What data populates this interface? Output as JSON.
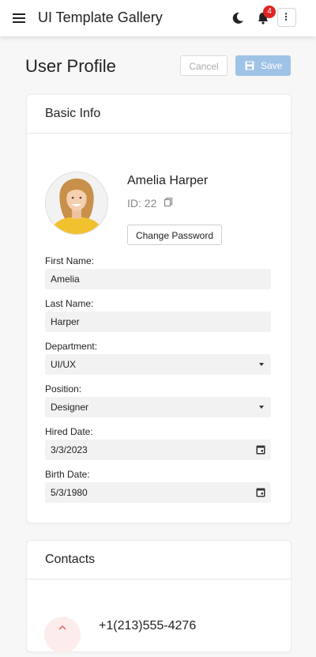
{
  "app": {
    "title": "UI Template Gallery",
    "notifications_count": "4"
  },
  "page": {
    "title": "User Profile",
    "cancel_label": "Cancel",
    "save_label": "Save"
  },
  "basic_info": {
    "title": "Basic Info",
    "name": "Amelia Harper",
    "id_text": "ID: 22",
    "change_password_label": "Change Password",
    "fields": {
      "first_name": {
        "label": "First Name:",
        "value": "Amelia"
      },
      "last_name": {
        "label": "Last Name:",
        "value": "Harper"
      },
      "department": {
        "label": "Department:",
        "value": "UI/UX"
      },
      "position": {
        "label": "Position:",
        "value": "Designer"
      },
      "hired_date": {
        "label": "Hired Date:",
        "value": "3/3/2023"
      },
      "birth_date": {
        "label": "Birth Date:",
        "value": "5/3/1980"
      }
    }
  },
  "contacts": {
    "title": "Contacts",
    "phone": "+1(213)555-4276"
  },
  "colors": {
    "accent": "#9fc3e6",
    "badge": "#e02424"
  },
  "icons": [
    "menu-icon",
    "moon-icon",
    "bell-icon",
    "more-vertical-icon",
    "save-icon",
    "copy-icon",
    "calendar-icon",
    "phone-icon"
  ]
}
